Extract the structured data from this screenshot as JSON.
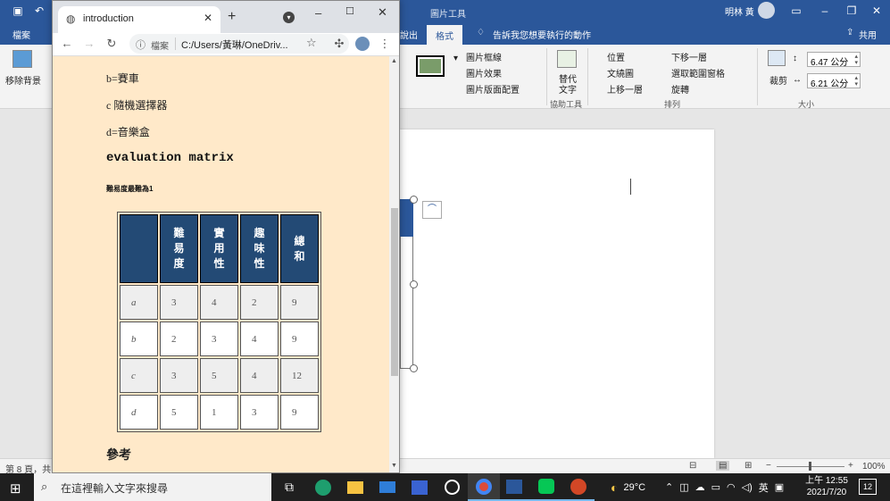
{
  "word": {
    "titlebar": {
      "context_label": "圖片工具",
      "user_name": "明林 黃",
      "icons": [
        "save-icon",
        "undo-icon",
        "account-avatar-icon",
        "ribbon-display-icon",
        "minimize-icon",
        "restore-icon",
        "close-icon"
      ]
    },
    "tabs": {
      "file": "檔案",
      "partial": "說出",
      "format": "格式",
      "tell_me": "告訴我您想要執行的動作",
      "share": "共用"
    },
    "ribbon": {
      "remove_bg": "移除背景",
      "picture_border": "圖片框線",
      "picture_effects": "圖片效果",
      "picture_layout": "圖片版面配置",
      "alt_text_line1": "替代",
      "alt_text_line2": "文字",
      "accessibility_label": "協助工具",
      "position": "位置",
      "wrap_text": "文繞圖",
      "bring_forward": "上移一層",
      "send_backward": "下移一層",
      "selection_pane": "選取範圍窗格",
      "rotate": "旋轉",
      "arrange_label": "排列",
      "crop": "裁剪",
      "height_value": "6.47 公分",
      "width_value": "6.21 公分",
      "size_label": "大小"
    },
    "status": {
      "page_info": "第 8 頁，共",
      "zoom": "100%",
      "minus": "−",
      "plus": "+"
    }
  },
  "chrome": {
    "tab_title": "introduction",
    "site_info_label": "檔案",
    "url": "C:/Users/黃琳/OneDriv...",
    "icons": [
      "globe-icon",
      "close-icon",
      "new-tab-icon",
      "tab-search-icon",
      "minimize-icon",
      "maximize-icon",
      "back-icon",
      "forward-icon",
      "reload-icon",
      "info-icon",
      "star-icon",
      "extensions-icon",
      "profile-icon",
      "menu-icon"
    ]
  },
  "page": {
    "lines": [
      "b=賽車",
      "c  隨機選擇器",
      "d=音樂盒"
    ],
    "heading": "evaluation matrix",
    "note": "難易度最難為1",
    "matrix": {
      "headers": [
        "",
        "難易度",
        "實用性",
        "趣味性",
        "總和"
      ],
      "rows": [
        {
          "label": "a",
          "values": [
            "3",
            "4",
            "2",
            "9"
          ]
        },
        {
          "label": "b",
          "values": [
            "2",
            "3",
            "4",
            "9"
          ]
        },
        {
          "label": "c",
          "values": [
            "3",
            "5",
            "4",
            "12"
          ]
        },
        {
          "label": "d",
          "values": [
            "5",
            "1",
            "3",
            "9"
          ]
        }
      ]
    },
    "ref_heading": "參考"
  },
  "taskbar": {
    "search_placeholder": "在這裡輸入文字來搜尋",
    "temperature": "29°C",
    "ime": "英",
    "time": "上午 12:55",
    "date": "2021/7/20",
    "notification_count": "12"
  }
}
